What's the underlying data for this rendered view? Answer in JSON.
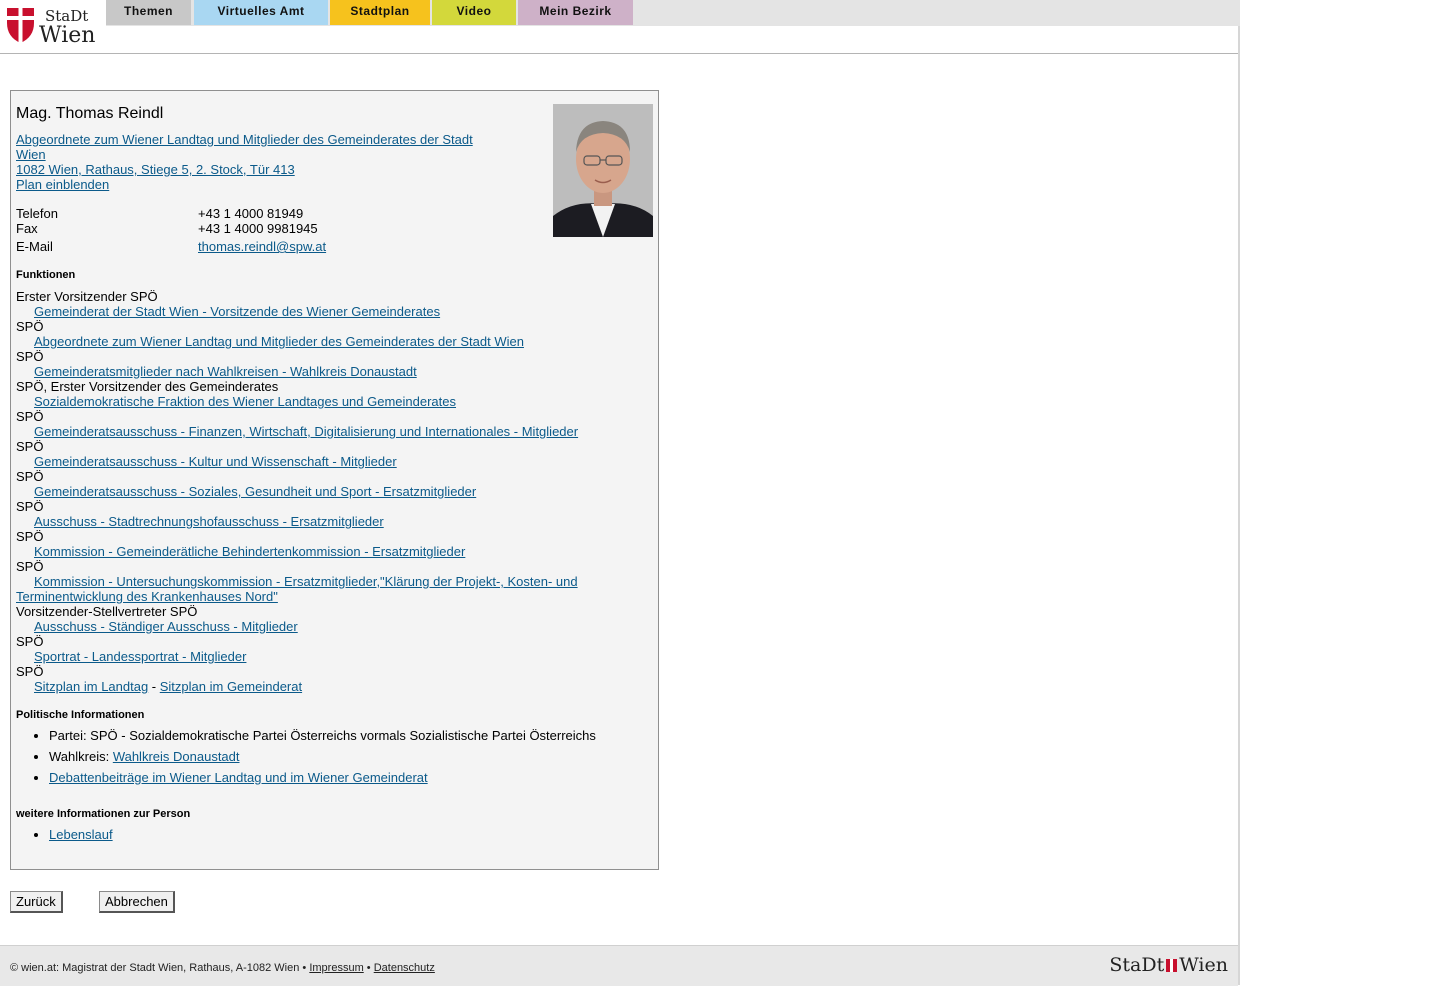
{
  "logo": {
    "line1": "StaDt",
    "line2": "Wien"
  },
  "nav": [
    {
      "label": "Themen",
      "color": "#c8c8c8"
    },
    {
      "label": "Virtuelles Amt",
      "color": "#a9d7f2"
    },
    {
      "label": "Stadtplan",
      "color": "#f6c21d"
    },
    {
      "label": "Video",
      "color": "#d3d83b"
    },
    {
      "label": "Mein Bezirk",
      "color": "#ceb1c8"
    }
  ],
  "person": {
    "name": "Mag. Thomas Reindl",
    "role_link_1": "Abgeordnete zum Wiener Landtag und Mitglieder des Gemeinderates der Stadt",
    "role_link_2": "Wien ",
    "address": "1082 Wien, Rathaus, Stiege 5, 2. Stock, Tür 413",
    "plan": "Plan einblenden",
    "phone_label": "Telefon",
    "phone": "+43 1 4000 81949",
    "fax_label": "Fax",
    "fax": "+43 1 4000 9981945",
    "email_label": "E-Mail",
    "email": "thomas.reindl@spw.at"
  },
  "functions_heading": "Funktionen",
  "functions": [
    {
      "role": "Erster Vorsitzender SPÖ",
      "link": "Gemeinderat der Stadt Wien - Vorsitzende des Wiener Gemeinderates"
    },
    {
      "role": "SPÖ",
      "link": "Abgeordnete zum Wiener Landtag und Mitglieder des Gemeinderates der Stadt Wien"
    },
    {
      "role": "SPÖ",
      "link": "Gemeinderatsmitglieder nach Wahlkreisen - Wahlkreis Donaustadt"
    },
    {
      "role": "SPÖ, Erster Vorsitzender des Gemeinderates",
      "link": "Sozialdemokratische Fraktion des Wiener Landtages und Gemeinderates"
    },
    {
      "role": "SPÖ",
      "link": "Gemeinderatsausschuss - Finanzen, Wirtschaft, Digitalisierung und Internationales - Mitglieder"
    },
    {
      "role": "SPÖ",
      "link": "Gemeinderatsausschuss - Kultur und Wissenschaft - Mitglieder"
    },
    {
      "role": "SPÖ",
      "link": "Gemeinderatsausschuss - Soziales, Gesundheit und Sport - Ersatzmitglieder"
    },
    {
      "role": "SPÖ",
      "link": "Ausschuss - Stadtrechnungshofausschuss - Ersatzmitglieder"
    },
    {
      "role": "SPÖ",
      "link": "Kommission - Gemeinderätliche Behindertenkommission - Ersatzmitglieder"
    },
    {
      "role": "SPÖ",
      "link": "Kommission - Untersuchungskommission - Ersatzmitglieder,\"Klärung der Projekt-, Kosten- und Terminentwicklung des Krankenhauses Nord\""
    },
    {
      "role": "Vorsitzender-Stellvertreter SPÖ",
      "link": "Ausschuss - Ständiger Ausschuss - Mitglieder"
    },
    {
      "role": "SPÖ",
      "link": "Sportrat - Landessportrat - Mitglieder"
    },
    {
      "role": "SPÖ",
      "link": ""
    }
  ],
  "seating": {
    "landtag": "Sitzplan im Landtag",
    "sep": " - ",
    "gemeinderat": "Sitzplan im Gemeinderat"
  },
  "political_heading": "Politische Informationen",
  "political": {
    "party": "Partei: SPÖ - Sozialdemokratische Partei Österreichs vormals Sozialistische Partei Österreichs",
    "district_label": "Wahlkreis: ",
    "district_link": "Wahlkreis Donaustadt",
    "debates": "Debattenbeiträge im Wiener Landtag und im Wiener Gemeinderat"
  },
  "more_heading": "weitere Informationen zur Person",
  "more": {
    "cv": "Lebenslauf"
  },
  "buttons": {
    "back": "Zurück",
    "cancel": "Abbrechen"
  },
  "footer": {
    "text": "© wien.at: Magistrat der Stadt Wien, Rathaus, A-1082 Wien • ",
    "impressum": "Impressum",
    "sep": " • ",
    "datenschutz": "Datenschutz",
    "logo_left": "StaDt",
    "logo_right": "Wien"
  }
}
